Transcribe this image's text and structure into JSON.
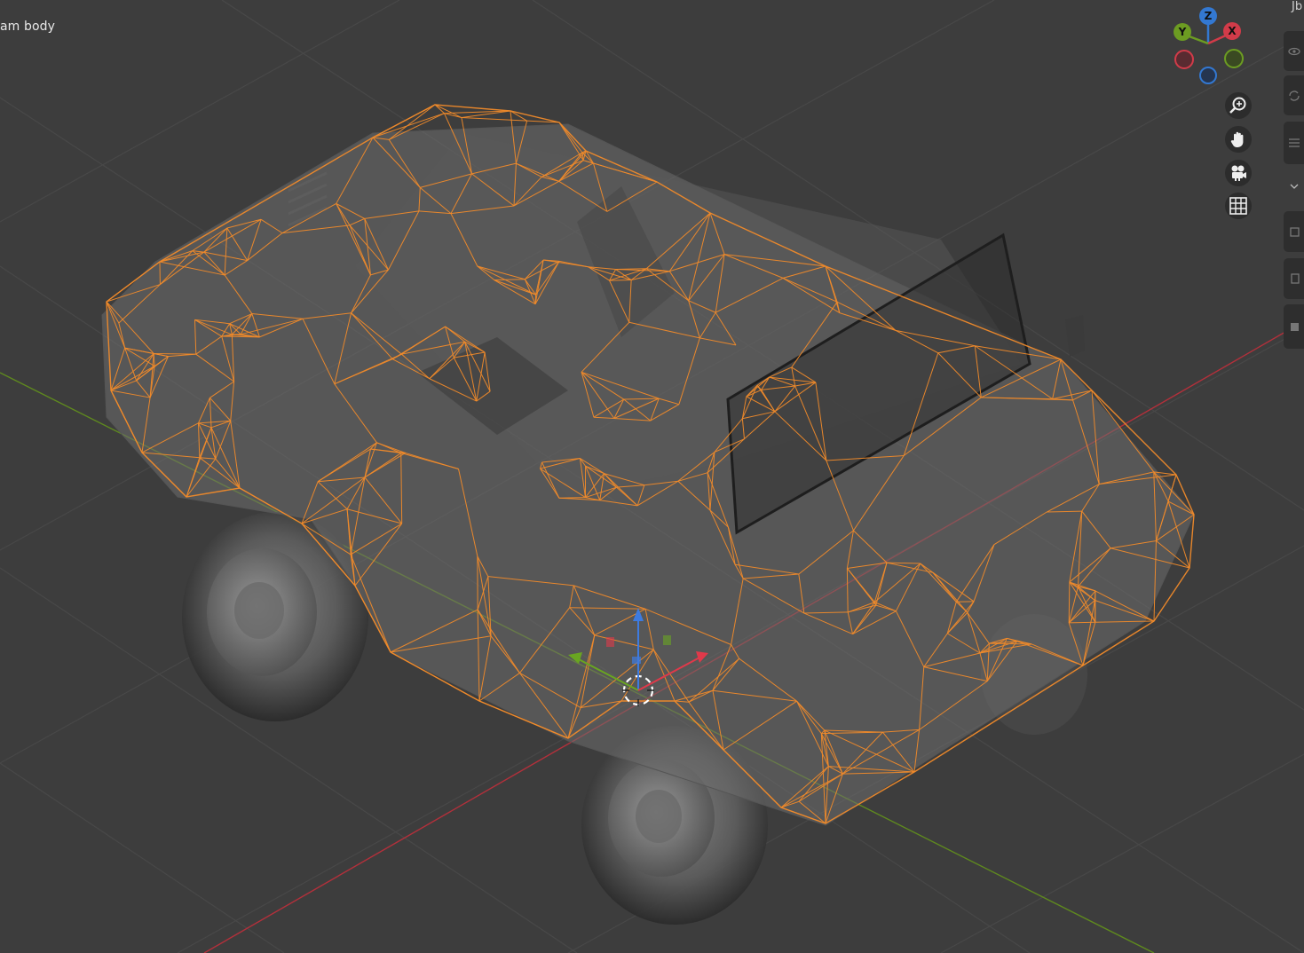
{
  "viewport": {
    "object_label": "am body",
    "sidebar_tab_label": "Jb"
  },
  "gizmo": {
    "axes": [
      {
        "name": "X",
        "color": "#d23b49"
      },
      {
        "name": "Y",
        "color": "#6c9c22"
      },
      {
        "name": "Z",
        "color": "#3378d1"
      }
    ]
  },
  "nav_buttons": [
    {
      "name": "zoom-icon"
    },
    {
      "name": "hand-pan-icon"
    },
    {
      "name": "camera-icon"
    },
    {
      "name": "grid-icon"
    }
  ],
  "colors": {
    "background": "#3d3d3d",
    "wireframe": "#f08a2a",
    "axis_x": "#b3303b",
    "axis_y": "#5f8a1e"
  }
}
